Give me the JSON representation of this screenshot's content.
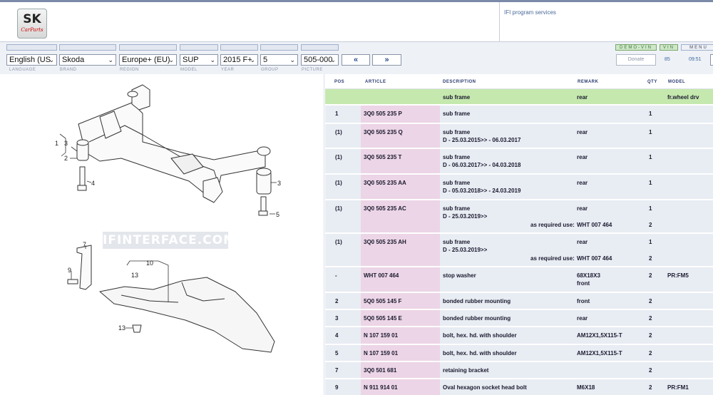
{
  "header": {
    "logo_text": "SK",
    "logo_subtext": "CarParts",
    "services_text": "IFI program services"
  },
  "toolbar": {
    "selects": {
      "language": "English (US",
      "brand": "Skoda",
      "region": "Europe+ (EU)",
      "model": "SUP",
      "year": "2015  F+",
      "group": "5",
      "picture": "505-000"
    },
    "prev_label": "«",
    "next_label": "»",
    "labels": {
      "language": "LANGUAGE",
      "brand": "BRAND",
      "region": "REGION",
      "model": "MODEL",
      "year": "YEAR",
      "group": "GROUP",
      "picture": "PICTURE"
    },
    "demo_vin_label": "DEMO-VIN",
    "vin_label": "VIN",
    "menu_label": "MENU",
    "donate_label": "Donate",
    "count": "85",
    "clock": "09:51"
  },
  "illustration": {
    "watermark": "IFINTERFACE.COM",
    "callouts": {
      "c1": "1",
      "c3a": "3",
      "c2": "2",
      "c4": "4",
      "c3b": "3",
      "c5": "5",
      "c7": "7",
      "c9": "9",
      "c10": "10",
      "c13a": "13",
      "c13b": "13"
    }
  },
  "table": {
    "headers": {
      "pos": "POS",
      "article": "ARTICLE",
      "description": "DESCRIPTION",
      "remark": "REMARK",
      "qty": "QTY",
      "model": "MODEL"
    },
    "rows": [
      {
        "pos": "",
        "article": "",
        "description": "sub frame",
        "description2": "",
        "remark": "rear",
        "remark2": "",
        "required": "",
        "required_val": "",
        "qty": "",
        "qty2": "",
        "model": "fr.wheel drv"
      },
      {
        "pos": "1",
        "article": "3Q0 505 235 P",
        "description": "sub frame",
        "description2": "",
        "remark": "",
        "remark2": "",
        "required": "",
        "required_val": "",
        "qty": "1",
        "qty2": "",
        "model": ""
      },
      {
        "pos": "(1)",
        "article": "3Q0 505 235 Q",
        "description": "sub frame",
        "description2": "D - 25.03.2015>> - 06.03.2017",
        "remark": "rear",
        "remark2": "",
        "required": "",
        "required_val": "",
        "qty": "1",
        "qty2": "",
        "model": ""
      },
      {
        "pos": "(1)",
        "article": "3Q0 505 235 T",
        "description": "sub frame",
        "description2": "D - 06.03.2017>> - 04.03.2018",
        "remark": "rear",
        "remark2": "",
        "required": "",
        "required_val": "",
        "qty": "1",
        "qty2": "",
        "model": ""
      },
      {
        "pos": "(1)",
        "article": "3Q0 505 235 AA",
        "description": "sub frame",
        "description2": "D - 05.03.2018>> - 24.03.2019",
        "remark": "rear",
        "remark2": "",
        "required": "",
        "required_val": "",
        "qty": "1",
        "qty2": "",
        "model": ""
      },
      {
        "pos": "(1)",
        "article": "3Q0 505 235 AC",
        "description": "sub frame",
        "description2": "D - 25.03.2019>>",
        "remark": "rear",
        "remark2": "",
        "required": "as required use:",
        "required_val": "WHT 007 464",
        "qty": "1",
        "qty2": "2",
        "model": ""
      },
      {
        "pos": "(1)",
        "article": "3Q0 505 235 AH",
        "description": "sub frame",
        "description2": "D - 25.03.2019>>",
        "remark": "rear",
        "remark2": "",
        "required": "as required use:",
        "required_val": "WHT 007 464",
        "qty": "1",
        "qty2": "2",
        "model": ""
      },
      {
        "pos": "-",
        "article": "WHT 007 464",
        "description": "stop washer",
        "description2": "",
        "remark": "68X18X3",
        "remark2": "front",
        "required": "",
        "required_val": "",
        "qty": "2",
        "qty2": "",
        "model": "PR:FM5"
      },
      {
        "pos": "2",
        "article": "5Q0 505 145 F",
        "description": "bonded rubber mounting",
        "description2": "",
        "remark": "front",
        "remark2": "",
        "required": "",
        "required_val": "",
        "qty": "2",
        "qty2": "",
        "model": ""
      },
      {
        "pos": "3",
        "article": "5Q0 505 145 E",
        "description": "bonded rubber mounting",
        "description2": "",
        "remark": "rear",
        "remark2": "",
        "required": "",
        "required_val": "",
        "qty": "2",
        "qty2": "",
        "model": ""
      },
      {
        "pos": "4",
        "article": "N  107 159 01",
        "description": "bolt, hex. hd. with shoulder",
        "description2": "",
        "remark": "AM12X1,5X115-T",
        "remark2": "",
        "required": "",
        "required_val": "",
        "qty": "2",
        "qty2": "",
        "model": ""
      },
      {
        "pos": "5",
        "article": "N  107 159 01",
        "description": "bolt, hex. hd. with shoulder",
        "description2": "",
        "remark": "AM12X1,5X115-T",
        "remark2": "",
        "required": "",
        "required_val": "",
        "qty": "2",
        "qty2": "",
        "model": ""
      },
      {
        "pos": "7",
        "article": "3Q0 501 681",
        "description": "retaining bracket",
        "description2": "",
        "remark": "",
        "remark2": "",
        "required": "",
        "required_val": "",
        "qty": "2",
        "qty2": "",
        "model": ""
      },
      {
        "pos": "9",
        "article": "N  911 914 01",
        "description": "Oval hexagon socket head bolt",
        "description2": "",
        "remark": "M6X18",
        "remark2": "",
        "required": "",
        "required_val": "",
        "qty": "2",
        "qty2": "",
        "model": "PR:FM1"
      }
    ]
  }
}
